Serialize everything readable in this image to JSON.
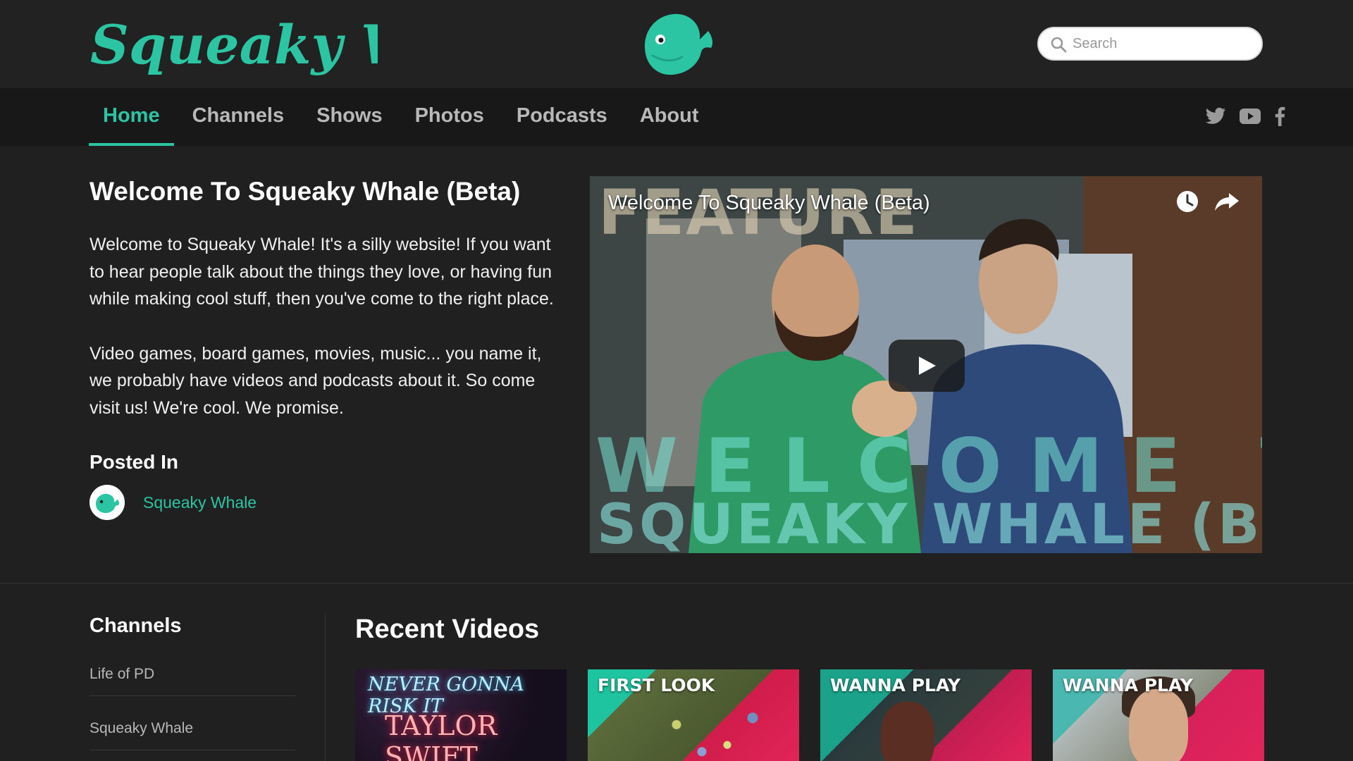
{
  "site": {
    "logo_text": "Squeaky Whale",
    "accent_color": "#2cc5a3",
    "mascot_icon": "whale-mascot-icon"
  },
  "search": {
    "placeholder": "Search",
    "value": ""
  },
  "nav": {
    "items": [
      {
        "label": "Home",
        "active": true
      },
      {
        "label": "Channels",
        "active": false
      },
      {
        "label": "Shows",
        "active": false
      },
      {
        "label": "Photos",
        "active": false
      },
      {
        "label": "Podcasts",
        "active": false
      },
      {
        "label": "About",
        "active": false
      }
    ],
    "social_icons": [
      "twitter-icon",
      "youtube-icon",
      "facebook-icon"
    ]
  },
  "feature": {
    "title": "Welcome To Squeaky Whale (Beta)",
    "paragraphs": [
      "Welcome to Squeaky Whale! It's a silly website! If you want to hear people talk about the things they love, or having fun while making cool stuff, then you've come to the right place.",
      "Video games, board games, movies, music... you name it, we probably have videos and podcasts about it. So come visit us! We're cool. We promise."
    ],
    "posted_in_label": "Posted In",
    "posted_in_channel": "Squeaky Whale"
  },
  "video": {
    "title": "Welcome To Squeaky Whale (Beta)",
    "badge": "FEATURE",
    "overlay_line1": "WELCOME TO",
    "overlay_line2": "SQUEAKY WHALE (BETA)",
    "icons": [
      "clock-icon",
      "share-icon",
      "play-icon"
    ]
  },
  "sidebar": {
    "title": "Channels",
    "items": [
      "Life of PD",
      "Squeaky Whale"
    ]
  },
  "recent": {
    "title": "Recent Videos",
    "videos": [
      {
        "label": "",
        "neon_line1": "NEVER GONNA RISK IT",
        "neon_line2": "TAYLOR SWIFT"
      },
      {
        "label": "FIRST LOOK"
      },
      {
        "label": "WANNA PLAY"
      },
      {
        "label": "WANNA PLAY"
      }
    ]
  }
}
